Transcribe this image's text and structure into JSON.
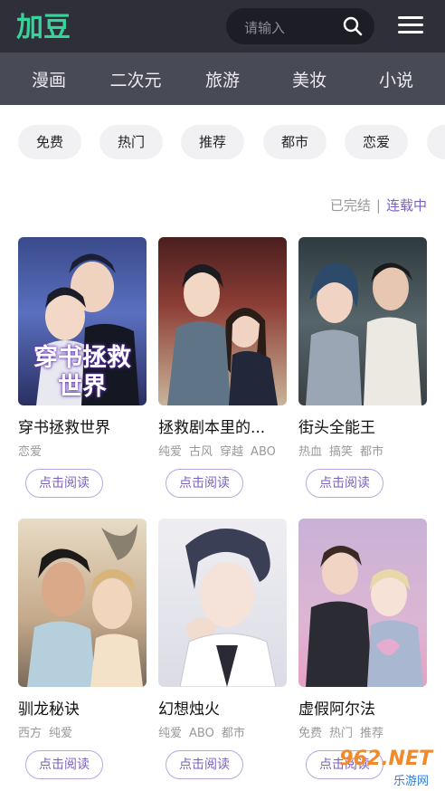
{
  "header": {
    "logo_text": "加豆",
    "search_placeholder": "请输入",
    "colors": {
      "accent": "#35d49b",
      "purple": "#7b5fc0"
    }
  },
  "categories": [
    "漫画",
    "二次元",
    "旅游",
    "美妆",
    "小说"
  ],
  "tags": [
    "免费",
    "热门",
    "推荐",
    "都市",
    "恋爱"
  ],
  "status": {
    "done": "已完结",
    "separator": "|",
    "ongoing": "连载中"
  },
  "comics": [
    {
      "title": "穿书拯救世界",
      "cover_text": "穿书拯救世界",
      "tags": [
        "恋爱"
      ],
      "button": "点击阅读"
    },
    {
      "title": "拯救剧本里的...",
      "tags": [
        "纯爱",
        "古风",
        "穿越",
        "ABO"
      ],
      "button": "点击阅读"
    },
    {
      "title": "街头全能王",
      "tags": [
        "热血",
        "搞笑",
        "都市"
      ],
      "button": "点击阅读"
    },
    {
      "title": "驯龙秘诀",
      "tags": [
        "西方",
        "纯爱"
      ],
      "button": "点击阅读"
    },
    {
      "title": "幻想烛火",
      "tags": [
        "纯爱",
        "ABO",
        "都市"
      ],
      "button": "点击阅读"
    },
    {
      "title": "虚假阿尔法",
      "tags": [
        "免费",
        "热门",
        "推荐"
      ],
      "button": "点击阅读"
    }
  ],
  "watermark": {
    "brand": "962.NET",
    "sub": "乐游网"
  }
}
